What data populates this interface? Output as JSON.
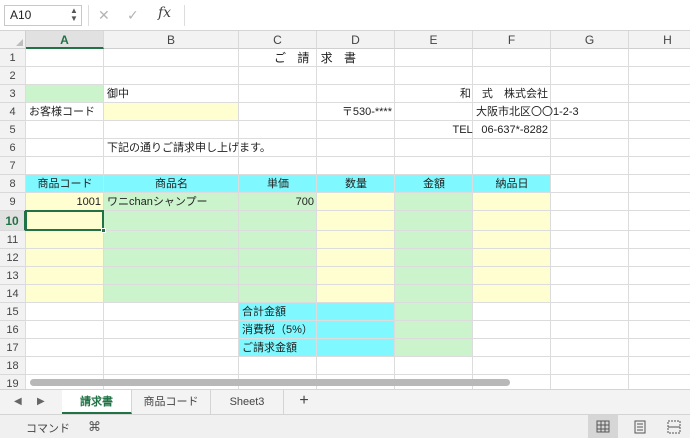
{
  "formula_bar": {
    "name_box": "A10",
    "cancel_icon": "✕",
    "enter_icon": "✓",
    "fx_label": "fx",
    "formula": ""
  },
  "grid": {
    "columns": [
      "A",
      "B",
      "C",
      "D",
      "E",
      "F",
      "G",
      "H"
    ],
    "rows": [
      "1",
      "2",
      "3",
      "4",
      "5",
      "6",
      "7",
      "8",
      "9",
      "10",
      "11",
      "12",
      "13",
      "14",
      "15",
      "16",
      "17",
      "18",
      "19"
    ],
    "selected_column": "A",
    "selected_row": "10",
    "colors": {
      "header_cyan": "#7ff9ff",
      "light_green": "#cbf4cc",
      "light_yellow": "#fffed0",
      "selection": "#217346"
    }
  },
  "cells": {
    "C1": "ご 請 求 書",
    "B3": "御中",
    "F3": "和 式 株式会社",
    "A4": "お客様コード",
    "D4": "〒530-****",
    "F4": "大阪市北区〇〇1-2-3",
    "F5": "TEL 06-637*-8282",
    "B6": "下記の通りご請求申し上げます。",
    "A8": "商品コード",
    "B8": "商品名",
    "C8": "単価",
    "D8": "数量",
    "E8": "金額",
    "F8": "納品日",
    "A9": "1001",
    "B9": "ワニchanシャンプー",
    "C9": "700",
    "C15": "合計金額",
    "C16": "消費税（5%）",
    "C17": "ご請求金額"
  },
  "sheet_tabs": {
    "prev_icon": "◀",
    "next_icon": "▶",
    "tabs": [
      "請求書",
      "商品コード",
      "Sheet3"
    ],
    "active": "請求書",
    "add_icon": "+"
  },
  "status_bar": {
    "mode": "コマンド",
    "macro_icon": "⌘"
  }
}
